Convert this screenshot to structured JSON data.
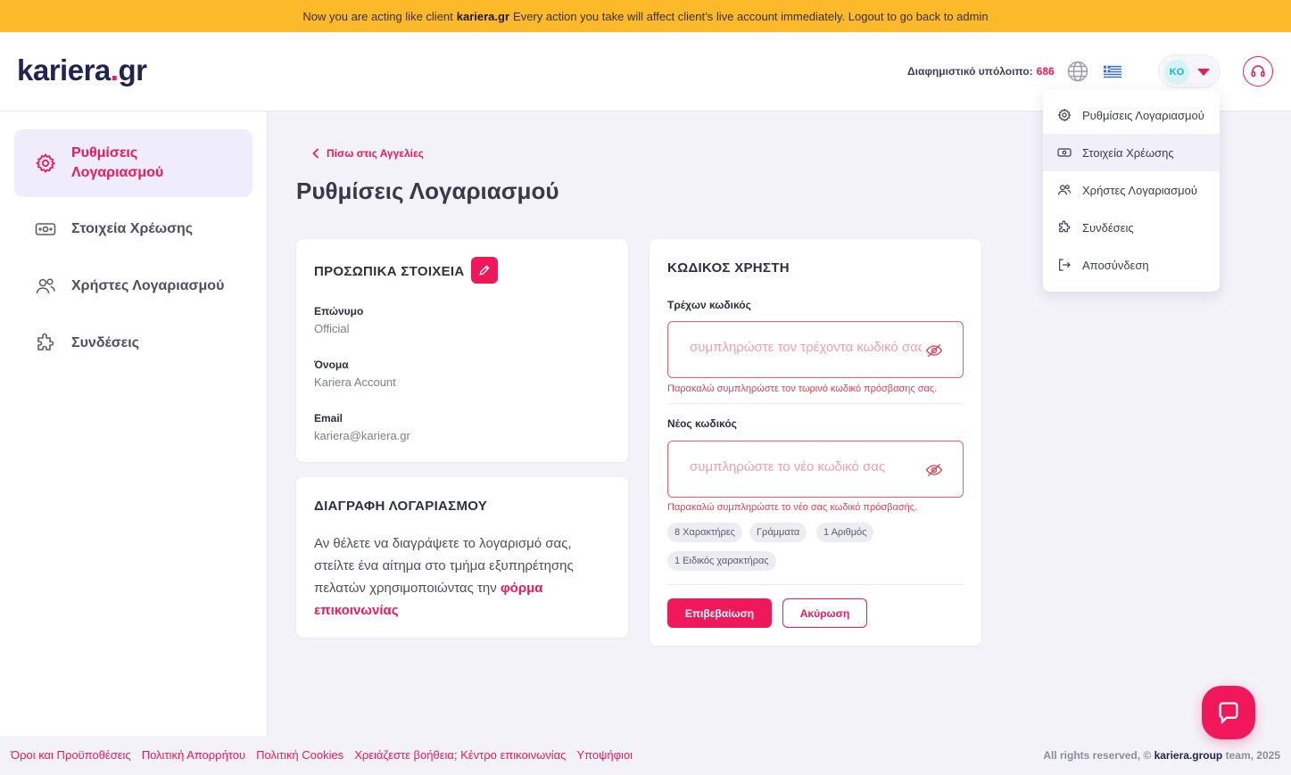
{
  "banner": {
    "prefix": "Now you are acting like client",
    "client": "kariera.gr",
    "suffix": "Every action you take will affect client’s live account immediately. Logout to go back to admin"
  },
  "header": {
    "logo_main": "kariera",
    "logo_dot": ".",
    "logo_tld": "gr",
    "credit_label": "Διαφημιστικό υπόλοιπο:",
    "credit_value": "686",
    "avatar_initials": "KO"
  },
  "sidebar": {
    "items": [
      {
        "label": "Ρυθμίσεις Λογαριασμού",
        "icon": "gear-icon",
        "active": true
      },
      {
        "label": "Στοιχεία Χρέωσης",
        "icon": "billing-icon"
      },
      {
        "label": "Χρήστες Λογαριασμού",
        "icon": "users-icon"
      },
      {
        "label": "Συνδέσεις",
        "icon": "puzzle-icon"
      }
    ]
  },
  "main": {
    "back_link": "Πίσω στις Αγγελίες",
    "title": "Ρυθμίσεις Λογαριασμού"
  },
  "personal": {
    "title": "ΠΡΟΣΩΠΙΚΑ ΣΤΟΙΧΕΙΑ",
    "fields": [
      {
        "label": "Επώνυμο",
        "value": "Official"
      },
      {
        "label": "Όνομα",
        "value": "Kariera Account"
      },
      {
        "label": "Email",
        "value": "kariera@kariera.gr"
      }
    ]
  },
  "delete": {
    "title": "ΔΙΑΓΡΑΦΗ ΛΟΓΑΡΙΑΣΜΟΥ",
    "text": "Αν θέλετε να διαγράψετε το λογαρισμό σας, στείλτε ένα αίτημα στο τμήμα εξυπηρέτησης πελατών χρησιμοποιώντας την",
    "link": "φόρμα επικοινωνίας"
  },
  "password": {
    "title": "ΚΩΔΙΚΟΣ ΧΡΗΣΤΗ",
    "current_label": "Τρέχων κωδικός",
    "current_placeholder": "συμπληρώστε τον τρέχοντα κωδικό σας",
    "current_error": "Παρακαλώ συμπληρώστε τον τωρινό κωδικό πρόσβασης σας.",
    "new_label": "Νέος κωδικός",
    "new_placeholder": "συμπληρώστε το νέο κωδικό σας",
    "new_error": "Παρακαλώ συμπληρώστε το νέο σας κωδικό πρόσβασής.",
    "chips": [
      "8 Χαρακτήρες",
      "Γράμματα",
      "1 Αριθμός",
      "1 Ειδικός χαρακτήρας"
    ],
    "confirm": "Επιβεβαίωση",
    "cancel": "Ακύρωση"
  },
  "dropdown": {
    "items": [
      {
        "label": "Ρυθμίσεις Λογαριασμού",
        "icon": "gear-icon"
      },
      {
        "label": "Στοιχεία Χρέωσης",
        "icon": "billing-icon"
      },
      {
        "label": "Χρήστες Λογαριασμού",
        "icon": "users-icon"
      },
      {
        "label": "Συνδέσεις",
        "icon": "puzzle-icon"
      },
      {
        "label": "Αποσύνδεση",
        "icon": "logout-icon"
      }
    ]
  },
  "footer": {
    "links": [
      "Όροι και Προϋποθέσεις",
      "Πολιτική Απορρήτου",
      "Πολιτική Cookies",
      "Χρειάζεστε βοήθεια; Κέντρο επικοινωνίας",
      "Υποψήφιοι"
    ],
    "copy_prefix": "All rights reserved, ©",
    "copy_brand": "kariera.group",
    "copy_suffix": "team, 2025"
  },
  "colors": {
    "accent": "#f0185a",
    "banner": "#fcb92a",
    "navy": "#1f2356"
  }
}
